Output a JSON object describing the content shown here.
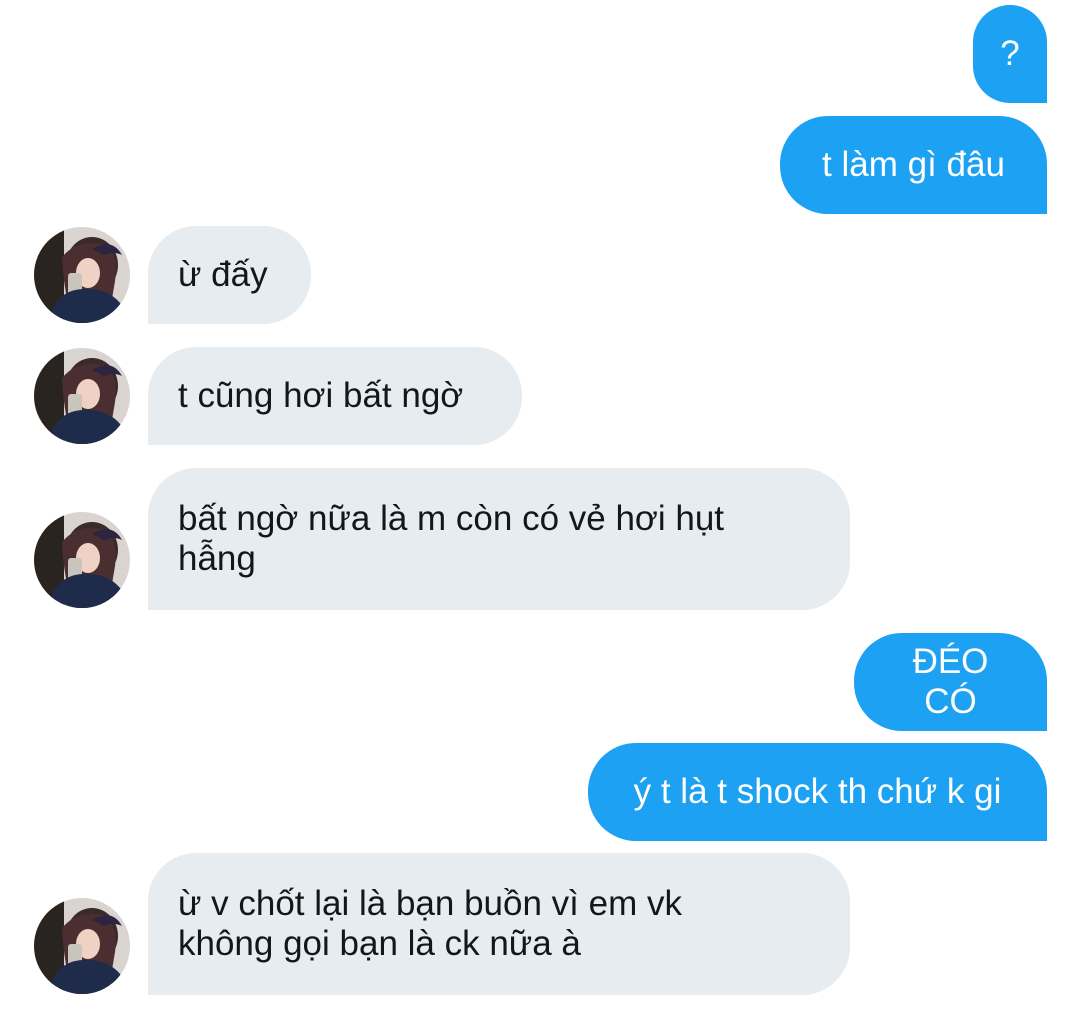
{
  "messages": [
    {
      "id": "m1",
      "side": "outgoing",
      "text": "?"
    },
    {
      "id": "m2",
      "side": "outgoing",
      "text": "t làm gì đâu"
    },
    {
      "id": "m3",
      "side": "incoming",
      "text": "ừ đấy",
      "avatar_icon": "profile-avatar"
    },
    {
      "id": "m4",
      "side": "incoming",
      "text": "t cũng hơi bất ngờ",
      "avatar_icon": "profile-avatar"
    },
    {
      "id": "m5",
      "side": "incoming",
      "text": "bất ngờ nữa là m còn có vẻ hơi hụt\nhẫng",
      "avatar_icon": "profile-avatar"
    },
    {
      "id": "m6",
      "side": "outgoing",
      "text": "ĐÉO CÓ"
    },
    {
      "id": "m7",
      "side": "outgoing",
      "text": "ý t là t shock th chứ k gi"
    },
    {
      "id": "m8",
      "side": "incoming",
      "text": "ừ v chốt lại là bạn buồn vì em vk\nkhông gọi bạn là ck nữa à",
      "avatar_icon": "profile-avatar"
    }
  ],
  "colors": {
    "outgoing_bubble": "#1da1f2",
    "incoming_bubble": "#e6ecf0",
    "outgoing_text": "#ffffff",
    "incoming_text": "#14171a"
  }
}
